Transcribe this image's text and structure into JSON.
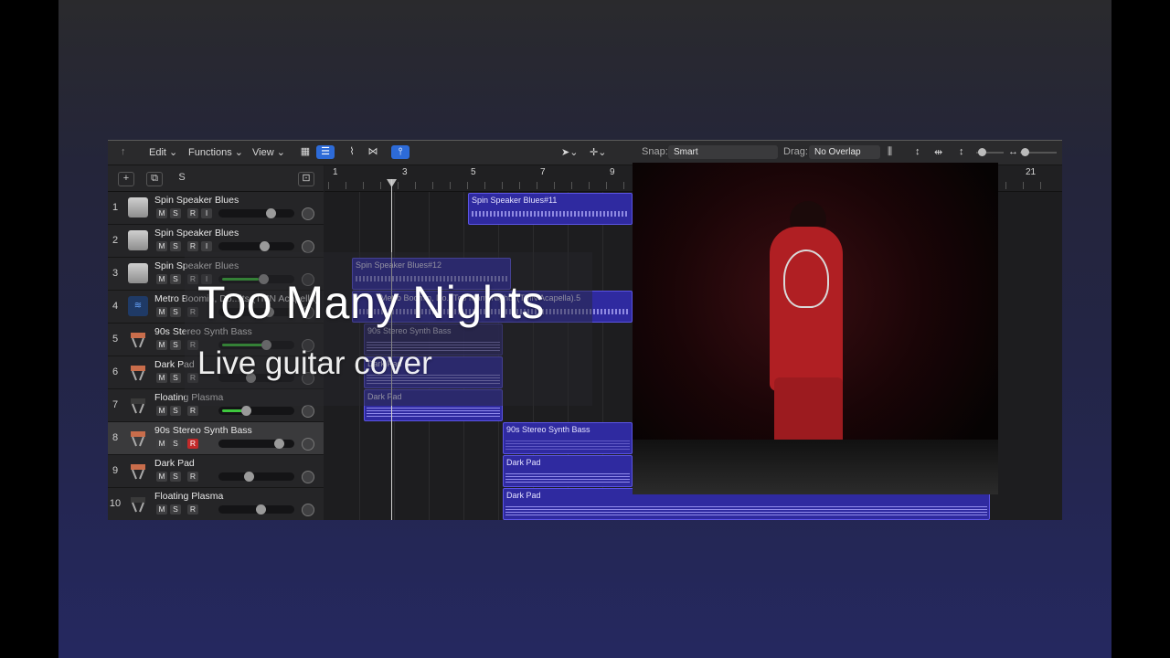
{
  "toolbar": {
    "back_icon": "back-arrow-icon",
    "edit_label": "Edit",
    "functions_label": "Functions",
    "view_label": "View",
    "snap_label": "Snap:",
    "snap_value": "Smart",
    "drag_label": "Drag:",
    "drag_value": "No Overlap"
  },
  "header": {
    "add_label": "+",
    "s_label": "S"
  },
  "ruler": {
    "bars": [
      "1",
      "3",
      "5",
      "7",
      "9",
      "21"
    ]
  },
  "tracks": [
    {
      "num": "1",
      "name": "Spin Speaker Blues",
      "m": "M",
      "s": "S",
      "r": "R",
      "i": "I",
      "icon": "amp-icon"
    },
    {
      "num": "2",
      "name": "Spin Speaker Blues",
      "m": "M",
      "s": "S",
      "r": "R",
      "i": "I",
      "icon": "amp-icon"
    },
    {
      "num": "3",
      "name": "Spin Speaker Blues",
      "m": "M",
      "s": "S",
      "r": "R",
      "i": "I",
      "icon": "amp-icon"
    },
    {
      "num": "4",
      "name": "Metro Boomin, Do...its (TMN Acapella)",
      "m": "M",
      "s": "S",
      "r": "R",
      "icon": "waveform-icon"
    },
    {
      "num": "5",
      "name": "90s Stereo Synth Bass",
      "m": "M",
      "s": "S",
      "r": "R",
      "icon": "synth-icon"
    },
    {
      "num": "6",
      "name": "Dark Pad",
      "m": "M",
      "s": "S",
      "r": "R",
      "icon": "synth-icon"
    },
    {
      "num": "7",
      "name": "Floating Plasma",
      "m": "M",
      "s": "S",
      "r": "R",
      "icon": "synth-icon"
    },
    {
      "num": "8",
      "name": "90s Stereo Synth Bass",
      "m": "M",
      "s": "S",
      "r": "R",
      "icon": "synth-icon"
    },
    {
      "num": "9",
      "name": "Dark Pad",
      "m": "M",
      "s": "S",
      "r": "R",
      "icon": "synth-icon"
    },
    {
      "num": "10",
      "name": "Floating Plasma",
      "m": "M",
      "s": "S",
      "r": "R",
      "icon": "synth-icon"
    }
  ],
  "regions": {
    "r1": "Spin Speaker Blues#11",
    "r3": "Spin Speaker Blues#12",
    "r4": "Metro Boomin, Do...Too Many Nights (TMN Acapella).5",
    "r5": "90s Stereo Synth Bass",
    "r6": "Dark Pad",
    "r7": "Dark Pad",
    "r8": "90s Stereo Synth Bass",
    "r9": "Dark Pad",
    "r10": "Dark Pad"
  },
  "overlay": {
    "title": "Too Many Nights",
    "subtitle": "Live guitar cover"
  },
  "colors": {
    "accent": "#2d6bd8",
    "region": "#2f2aa0",
    "record": "#c22a2a",
    "meter": "#3ec83e"
  }
}
